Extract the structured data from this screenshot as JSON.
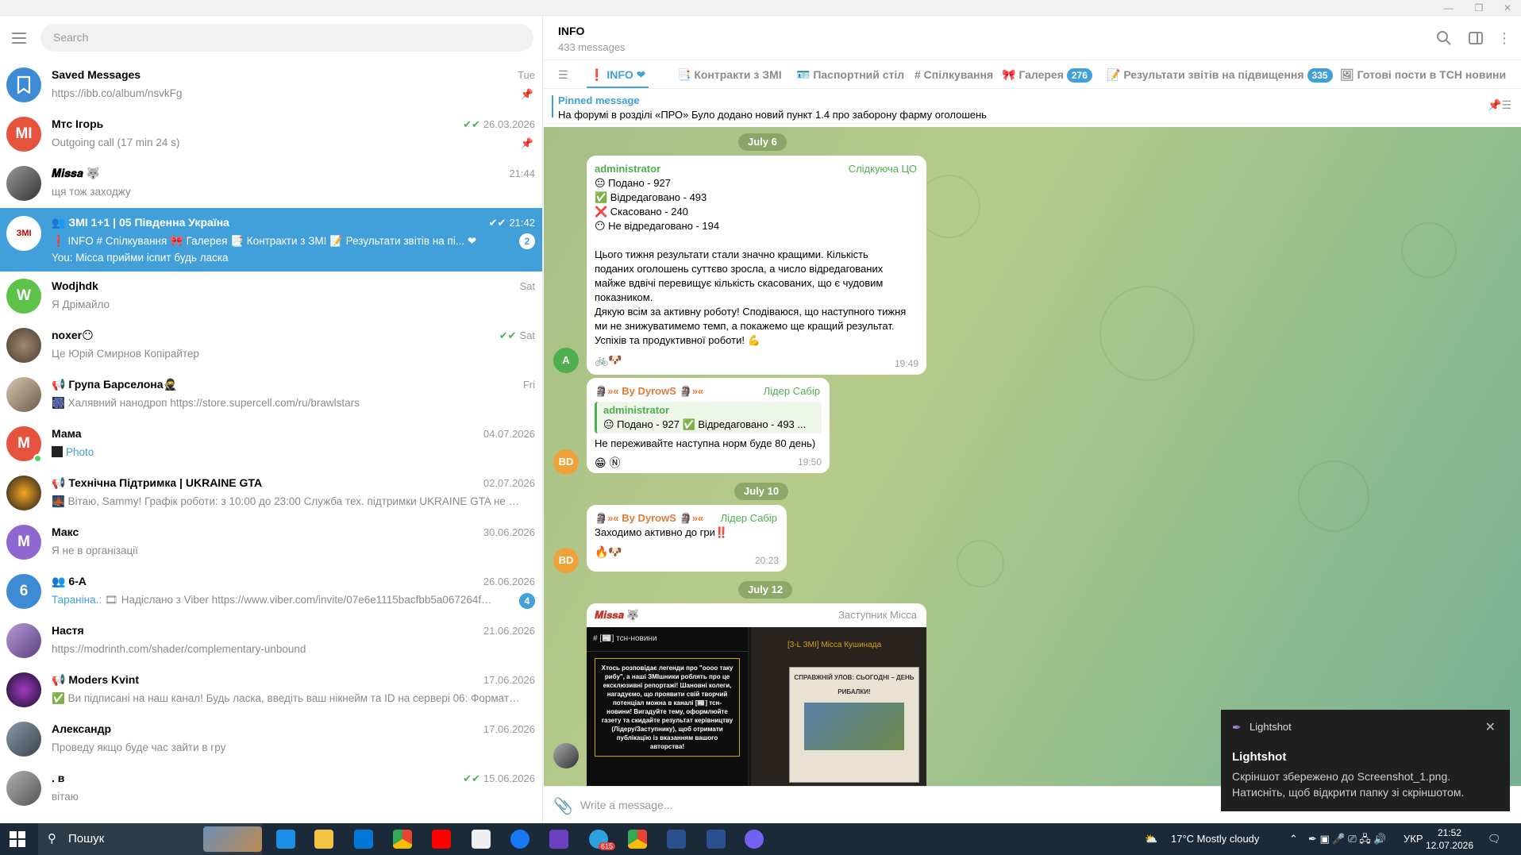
{
  "window": {
    "minimize": "—",
    "maximize": "❐",
    "close": "✕"
  },
  "sidebar": {
    "search_placeholder": "Search",
    "chats": [
      {
        "name": "Saved Messages",
        "time": "Tue",
        "preview": "https://ibb.co/album/nsvkFg",
        "avatar": "",
        "color": "#3d8bd4"
      },
      {
        "name": "Мтс Ігорь",
        "time": "26.03.2026",
        "preview": "Outgoing call (17 min 24 s)",
        "avatar": "MI",
        "color": "#e5533d"
      },
      {
        "name": "𝑴𝒊𝒔𝒔𝒂 🐺",
        "time": "21:44",
        "preview": "щя тож заходжу",
        "avatar": "",
        "color": "#444"
      },
      {
        "name": "👥 ЗМІ 1+1 | 05 Південна Україна",
        "time": "21:42",
        "preview": "❗ INFO  # Спілкування  🎀 Галерея  📑 Контракти з ЗМІ  📝 Результати звітів на пі... ❤",
        "preview2": "You: Місса прийми іспит будь ласка",
        "badge": "2",
        "avatar": "ЗМІ",
        "color": "#fff"
      },
      {
        "name": "Wodjhdk",
        "time": "Sat",
        "preview": "Я Дрімайло",
        "avatar": "W",
        "color": "#5cc248"
      },
      {
        "name": "noxer😶",
        "time": "Sat",
        "preview": "Це Юрій Смирнов Копірайтер",
        "avatar": "",
        "color": "#6b5c4e"
      },
      {
        "name": "📢 Група Барселона🥷",
        "time": "Fri",
        "preview": "🎆 Халявний нанодроп https://store.supercell.com/ru/brawlstars",
        "avatar": "",
        "color": "#a89a8a"
      },
      {
        "name": "Мама",
        "time": "04.07.2026",
        "preview": "Photo",
        "avatar": "M",
        "color": "#e5533d"
      },
      {
        "name": "📢 Технічна Підтримка | UKRAINE GTA",
        "time": "02.07.2026",
        "preview": "🌉 Вітаю, Sammy!  Графік роботи: з 10:00 до 23:00  Служба тех. підтримки UKRAINE GTA не на зв'я...",
        "avatar": "",
        "color": "#1a1a1a"
      },
      {
        "name": "Макс",
        "time": "30.06.2026",
        "preview": "Я не в організації",
        "avatar": "M",
        "color": "#8e68d0"
      },
      {
        "name": "👥 6-А",
        "time": "26.06.2026",
        "preview_prefix": "Тараніна.:",
        "preview": " 🎞 Надіслано з Viber https://www.viber.com/invite/07e6e1115bacfbb5a067264f6a86...",
        "badge": "4",
        "avatar": "6",
        "color": "#3d8bd4"
      },
      {
        "name": "Настя",
        "time": "21.06.2026",
        "preview": "https://modrinth.com/shader/complementary-unbound",
        "avatar": "",
        "color": "#8a6db3"
      },
      {
        "name": "📢 Moders Kvint",
        "time": "17.06.2026",
        "preview": "✅ Ви підписані на наш канал!  Будь ласка, введіть ваш нікнейм та ID на сервері 06: Формат: І . . .",
        "avatar": "",
        "color": "#2a1f3d"
      },
      {
        "name": "Александр",
        "time": "17.06.2026",
        "preview": "Проведу якщо буде час зайти в гру",
        "avatar": "",
        "color": "#56606b"
      },
      {
        "name": ". в",
        "time": "15.06.2026",
        "preview": "вітаю",
        "avatar": "",
        "color": "#7c7c7c"
      }
    ]
  },
  "chat": {
    "title": "INFO",
    "subtitle": "433 messages",
    "tabs": [
      {
        "label": "❗ INFO ❤"
      },
      {
        "label": "📑 Контракти з ЗМІ"
      },
      {
        "label": "🪪 Паспортний стіл"
      },
      {
        "label": "# Спілкування"
      },
      {
        "label": "🎀 Галерея",
        "badge": "276"
      },
      {
        "label": "📝 Результати звітів на підвищення",
        "badge": "335"
      },
      {
        "label": "🖼 Готові пости в ТСН новини"
      }
    ],
    "pinned_title": "Pinned message",
    "pinned_text": "На форумі в розділі «ПРО» Було додано новий пункт 1.4 про заборону фарму оголошень",
    "dates": [
      "July 6",
      "July 10",
      "July 12"
    ],
    "messages": [
      {
        "author": "administrator",
        "role": "Слідкуюча ЦО",
        "lines": [
          "😐 Подано - 927",
          "✅ Відредаговано - 493",
          "❌ Скасовано - 240",
          "😶 Не відредаговано - 194",
          "",
          "Цього тижня результати стали значно кращими. Кількість",
          "поданих оголошень суттєво зросла, а число відредагованих",
          "майже вдвічі перевищує кількість скасованих, що є чудовим",
          "показником.",
          "Дякую всім за активну роботу! Сподіваюся, що наступного тижня",
          "ми не знижуватимемо темп, а покажемо ще кращий результат.",
          "Успіхів та продуктивної роботи! 💪"
        ],
        "reactions": "🚲🐶",
        "time": "19:49",
        "avatar": "A"
      },
      {
        "author": "By DyrowS",
        "role": "Лідер Сабір",
        "reply_author": "administrator",
        "reply_text": "😐 Подано - 927 ✅ Відредаговано - 493 ...",
        "text": "Не переживайте наступна норм буде 80 день)",
        "reactions": "😁 Ⓝ",
        "time": "19:50",
        "avatar": "BD"
      },
      {
        "author": "By DyrowS",
        "role": "Лідер Сабір",
        "text": "Заходимо активно до гри‼️",
        "reactions": "🔥🐶",
        "time": "20:23",
        "avatar": "BD"
      },
      {
        "author": "𝑴𝒊𝒔𝒔𝒂 🐺",
        "role": "Заступник Місса",
        "img_left_title": "# [📰] тсн-новини",
        "img_left_text": "Хтось розповідає легенди про \"оооо таку рибу\", а наші ЗМІшники роблять про це ексклюзивні репортажі! Шановні колеги, нагадуємо, що проявити свій творчий потенціал можна в каналі [📰] тсн-новини! Вигадуйте тему, оформлюйте газету та скидайте результат керівництву (Лідеру/Заступнику), щоб отримати публікацію із вказанням вашого авторства!",
        "img_right_title": "[3-L ЗМІ] Місса Кушинада",
        "img_right_headline": "СПРАВЖНІЙ УЛОВ: СЬОГОДНІ – ДЕНЬ РИБАЛКИ!"
      }
    ],
    "input_placeholder": "Write a message..."
  },
  "toast": {
    "app": "Lightshot",
    "title": "Lightshot",
    "body": "Скріншот збережено до Screenshot_1.png. Натисніть, щоб відкрити папку зі скріншотом."
  },
  "taskbar": {
    "search": "Пошук",
    "weather": "17°C  Mostly cloudy",
    "lang": "УКР",
    "time": "21:52",
    "date": "12.07.2026",
    "telegram_badge": "615"
  }
}
